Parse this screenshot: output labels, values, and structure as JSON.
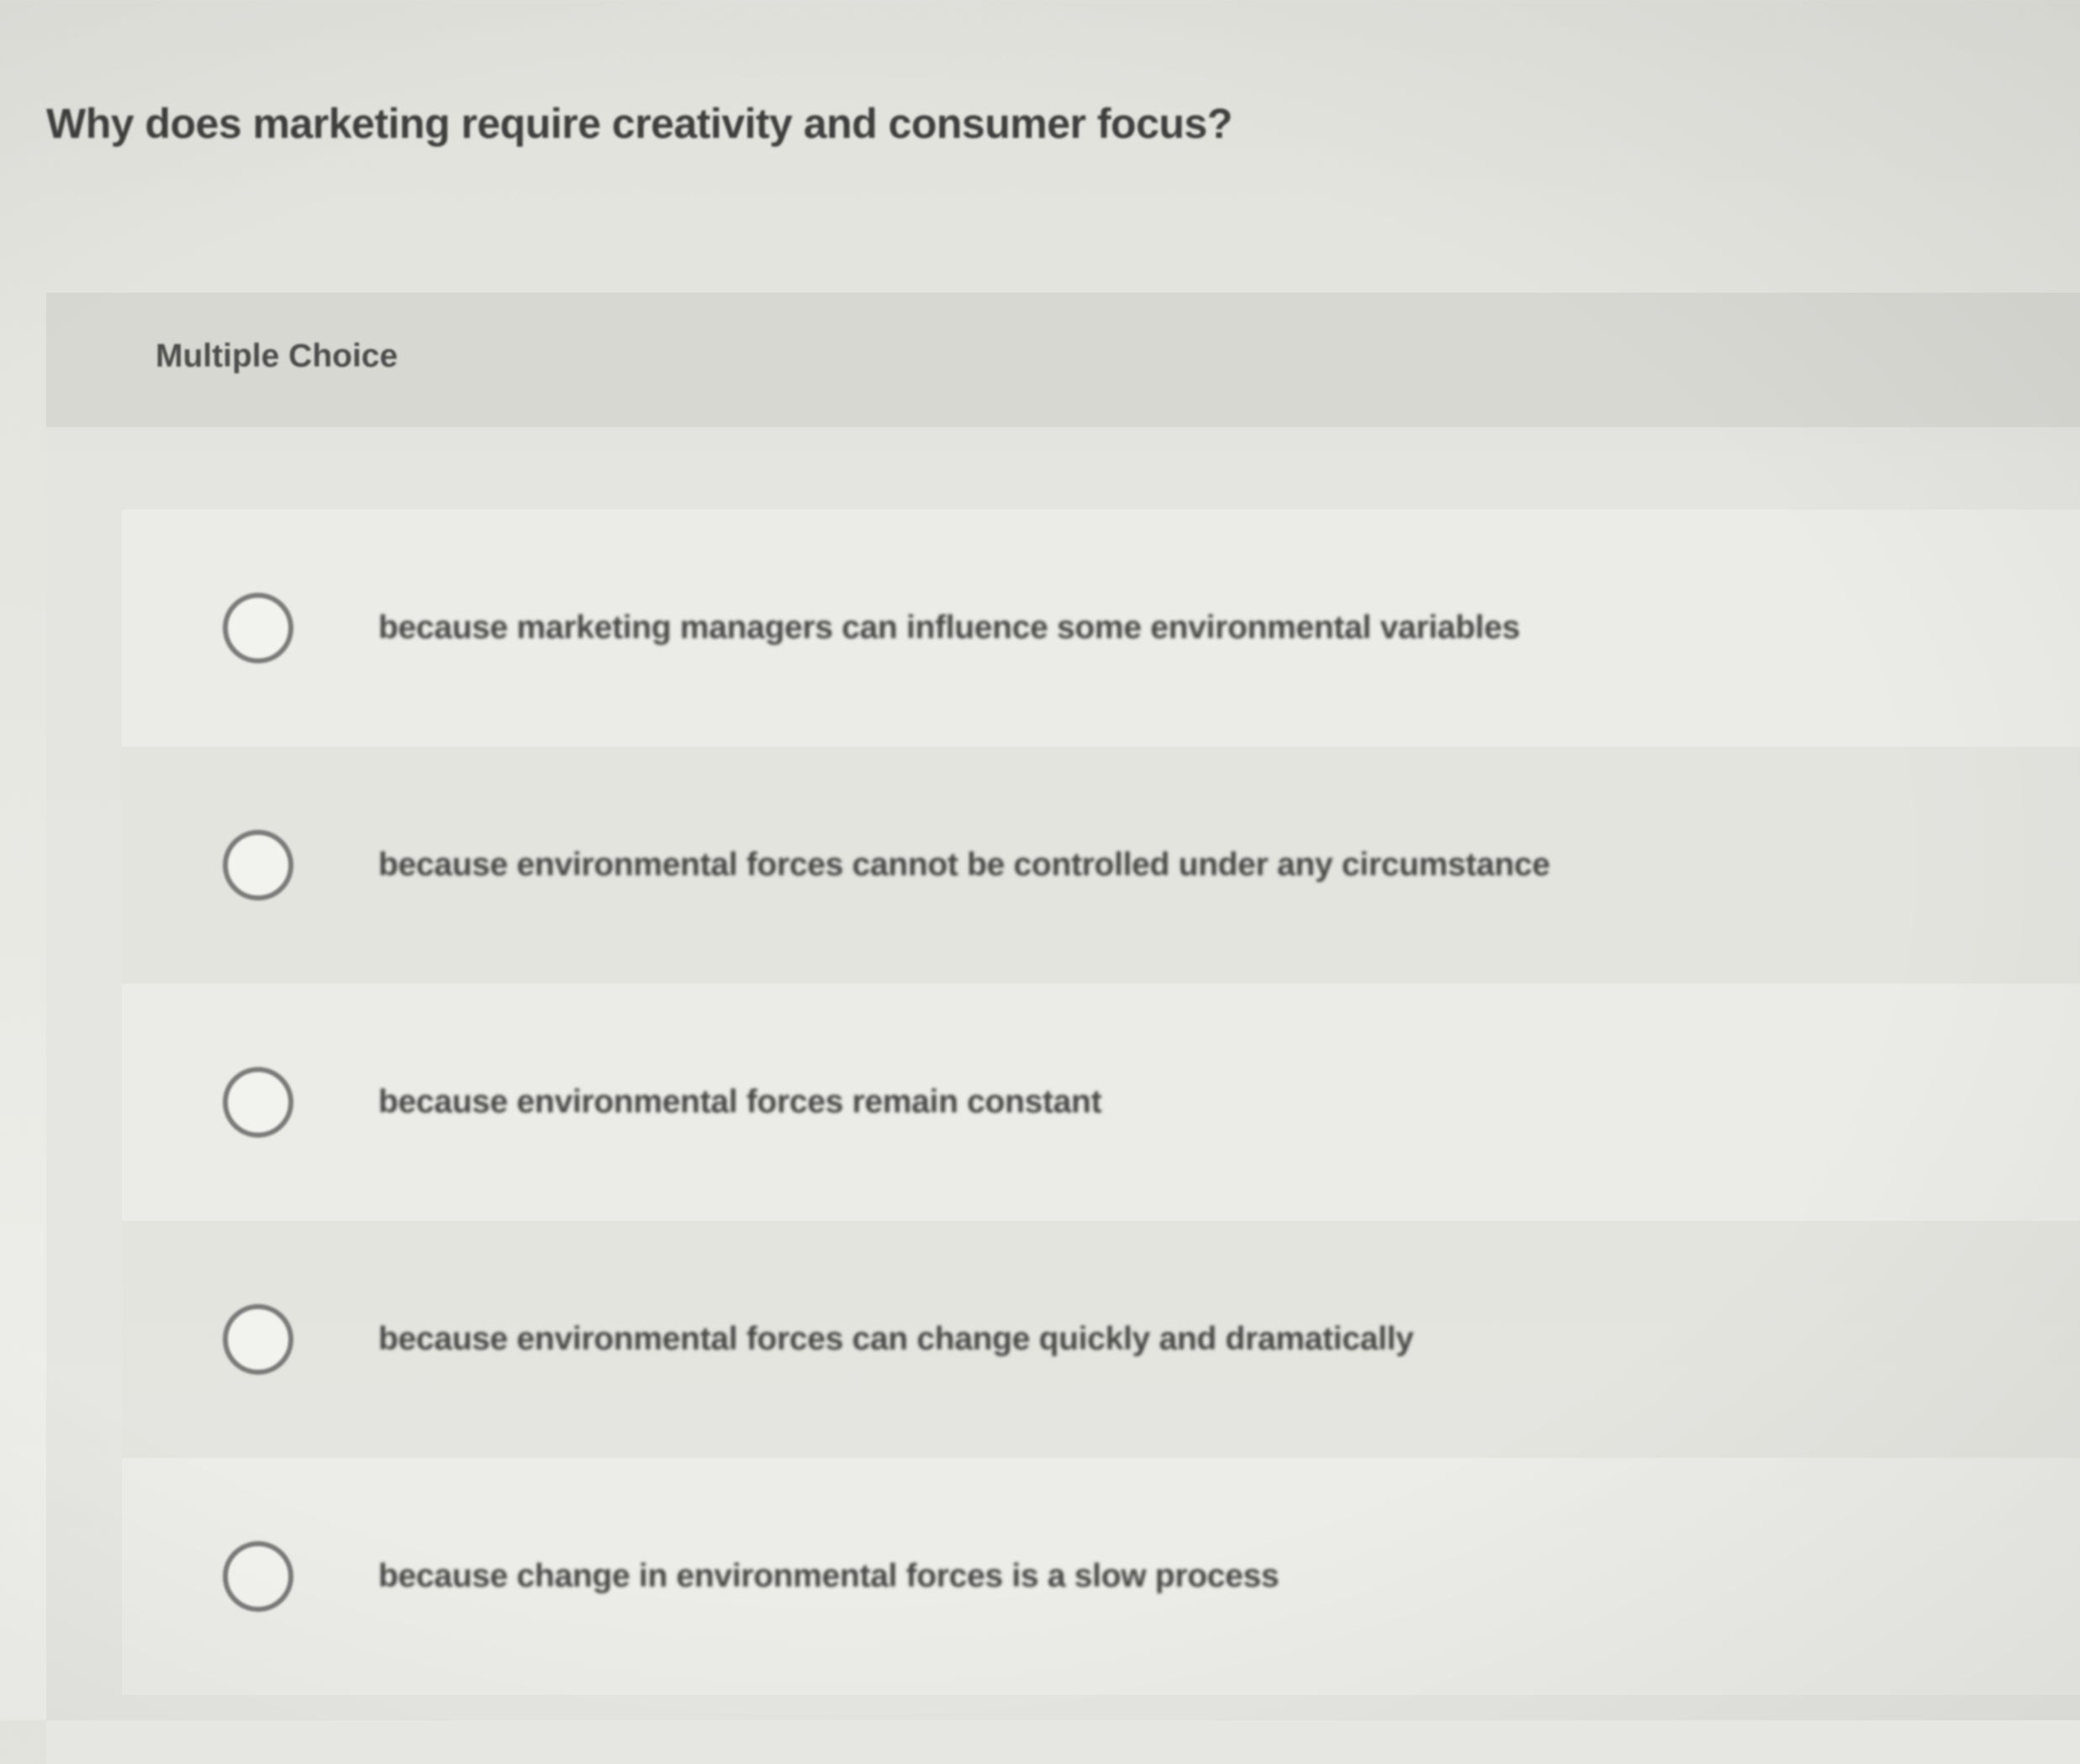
{
  "question": {
    "title": "Why does marketing require creativity and consumer focus?"
  },
  "panel": {
    "type_label": "Multiple Choice"
  },
  "options": [
    {
      "text": "because marketing managers can influence some environmental variables",
      "selected": false
    },
    {
      "text": "because environmental forces cannot be controlled under any circumstance",
      "selected": false
    },
    {
      "text": "because environmental forces remain constant",
      "selected": false
    },
    {
      "text": "because environmental forces can change quickly and dramatically",
      "selected": false
    },
    {
      "text": "because change in environmental forces is a slow process",
      "selected": false
    }
  ]
}
